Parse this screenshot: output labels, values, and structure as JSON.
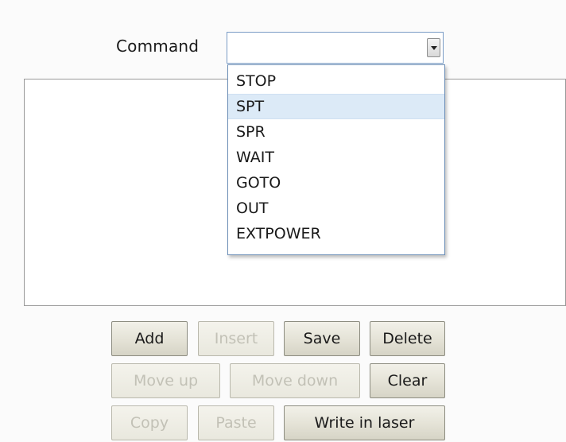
{
  "command": {
    "label": "Command",
    "value": "",
    "options": [
      "STOP",
      "SPT",
      "SPR",
      "WAIT",
      "GOTO",
      "OUT",
      "EXTPOWER"
    ],
    "hovered_option": "SPT"
  },
  "buttons": {
    "add": "Add",
    "insert": "Insert",
    "save": "Save",
    "delete": "Delete",
    "move_up": "Move up",
    "move_down": "Move down",
    "clear": "Clear",
    "copy": "Copy",
    "paste": "Paste",
    "write_in_laser": "Write in laser"
  },
  "disabled_buttons": [
    "Insert",
    "Move up",
    "Move down",
    "Copy",
    "Paste"
  ]
}
